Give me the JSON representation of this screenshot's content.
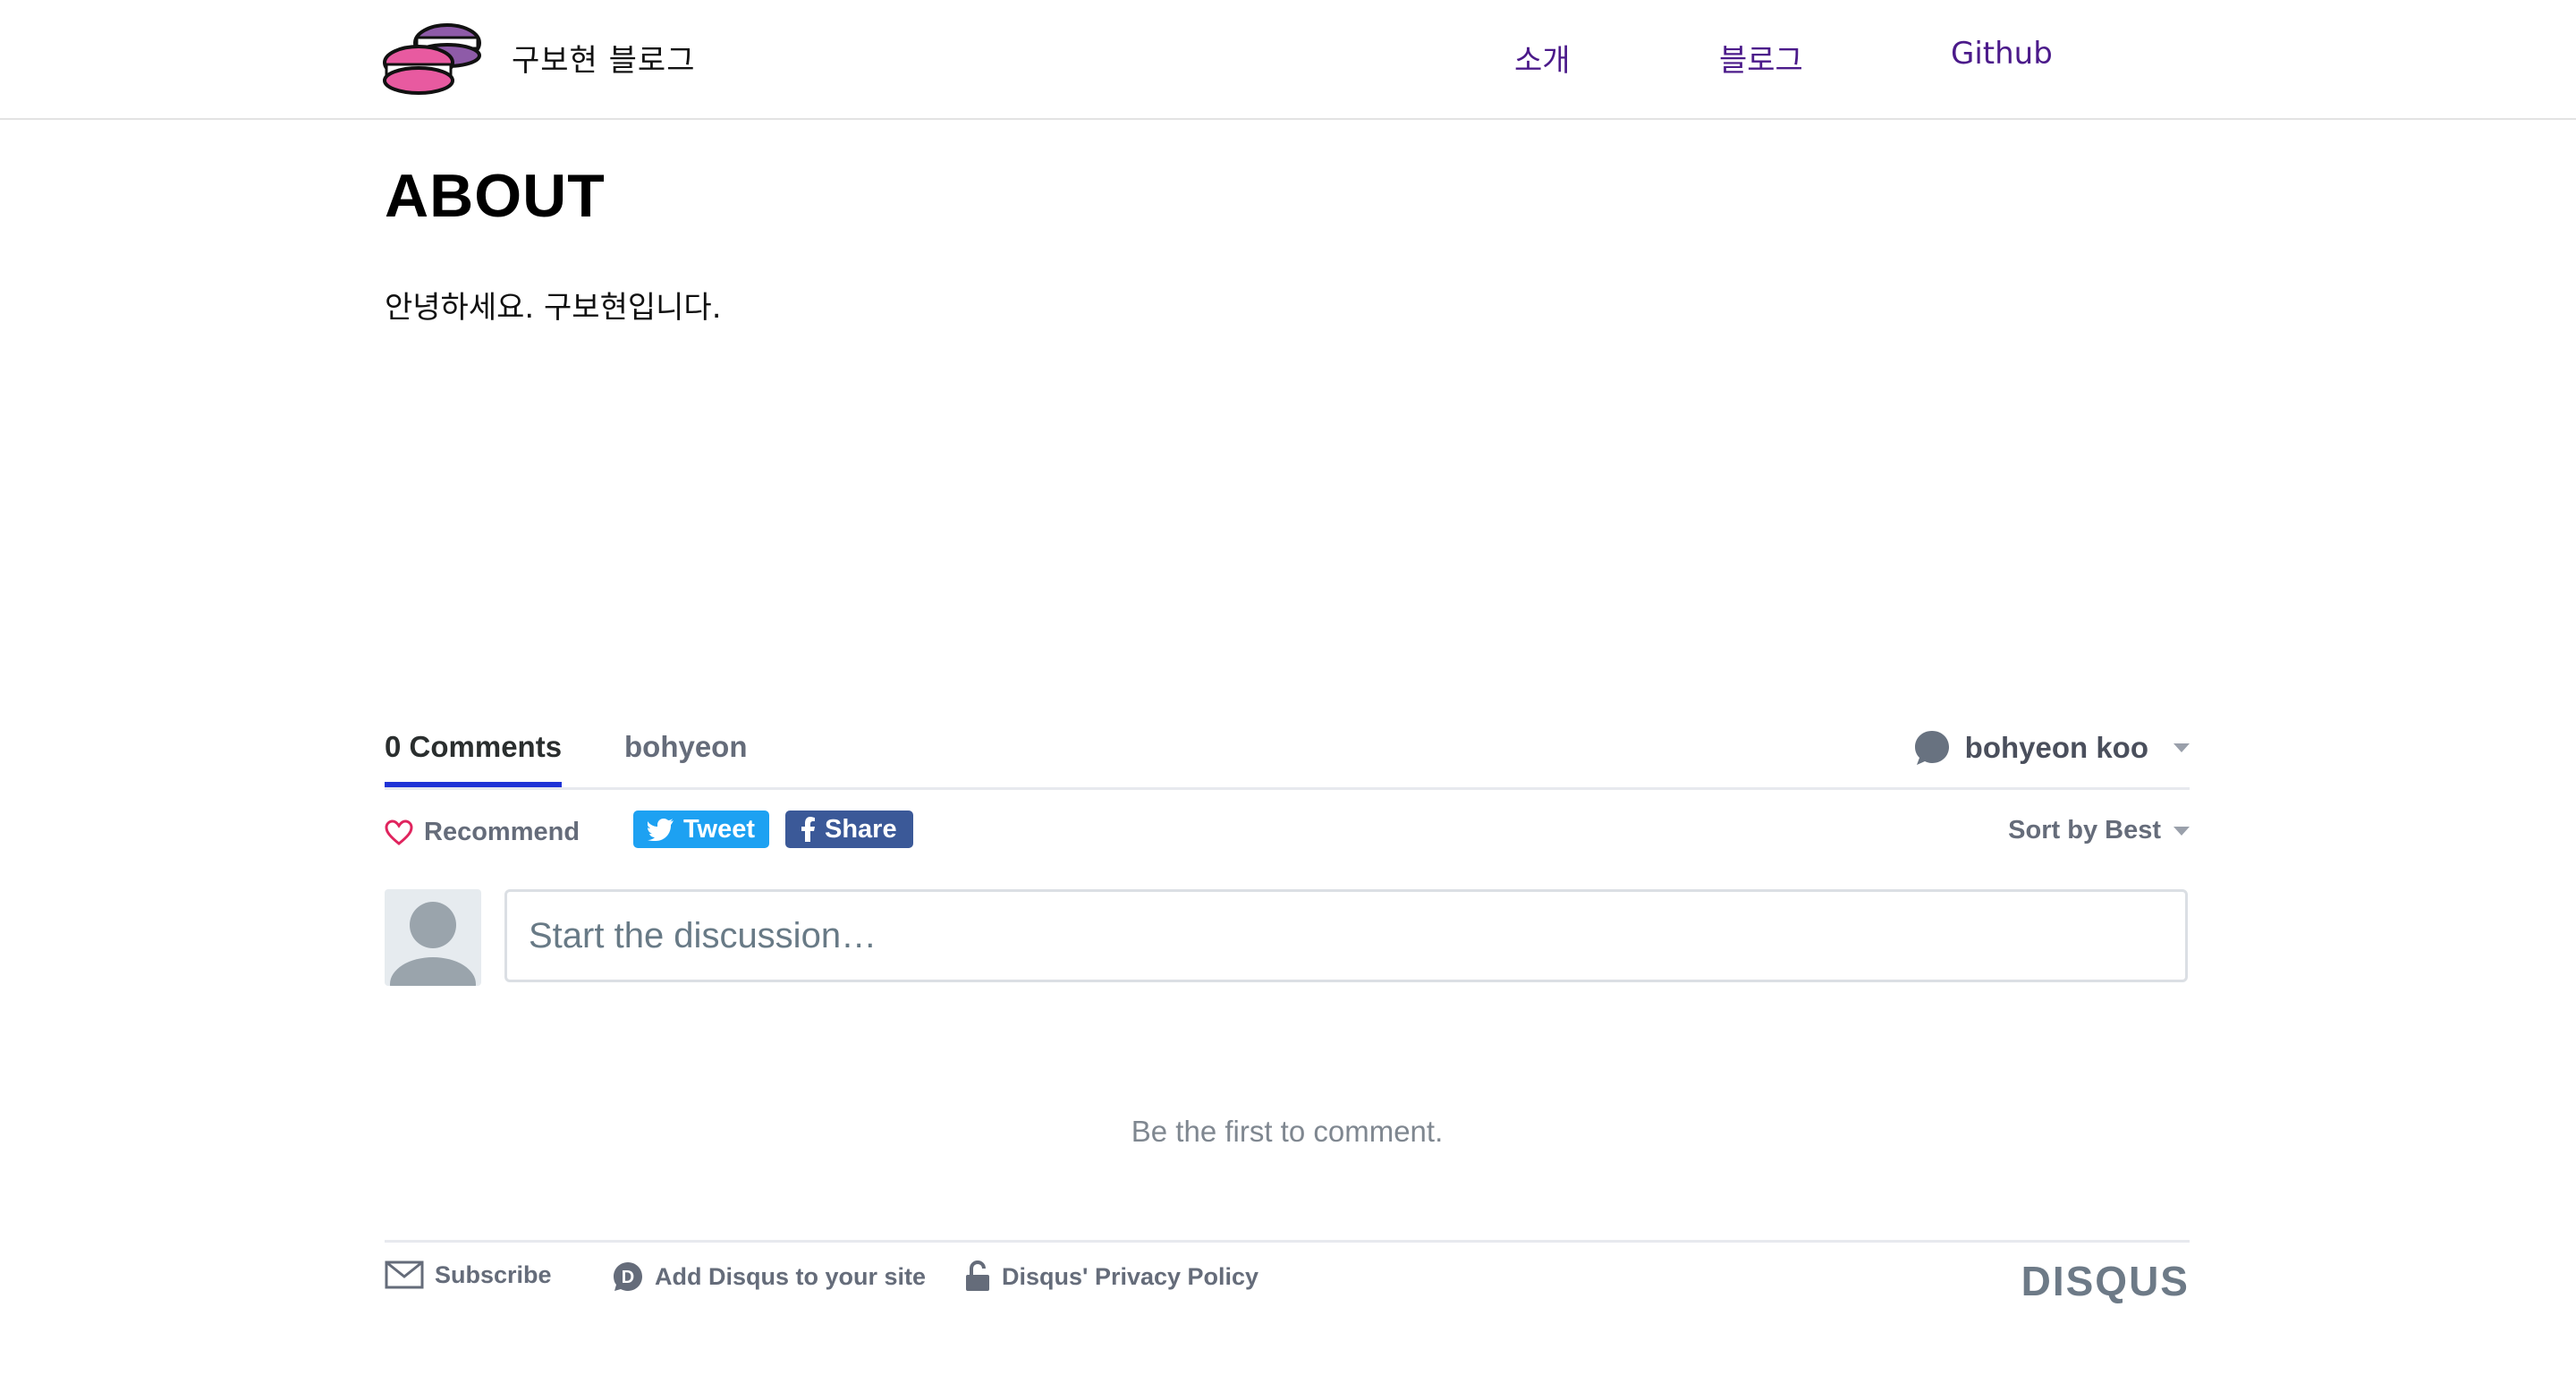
{
  "header": {
    "site_title": "구보현 블로그",
    "nav": {
      "about": "소개",
      "blog": "블로그",
      "github": "Github"
    },
    "logo_icon": "macaron-logo-icon",
    "nav_color": "#4b1a8a"
  },
  "main": {
    "title": "ABOUT",
    "intro": "안녕하세요. 구보현입니다."
  },
  "disqus": {
    "tabs": {
      "comments": "0 Comments",
      "forum": "bohyeon"
    },
    "user": {
      "name": "bohyeon koo"
    },
    "actions": {
      "recommend": "Recommend",
      "tweet": "Tweet",
      "share": "Share",
      "sort": "Sort by Best"
    },
    "composer": {
      "placeholder": "Start the discussion…"
    },
    "empty_message": "Be the first to comment.",
    "footer": {
      "subscribe": "Subscribe",
      "add_disqus": "Add Disqus to your site",
      "privacy": "Disqus' Privacy Policy",
      "brand": "DISQUS"
    },
    "colors": {
      "active_tab": "#1f33d6",
      "tweet": "#1da1f2",
      "facebook": "#3b5998",
      "heart": "#e0245e"
    }
  }
}
